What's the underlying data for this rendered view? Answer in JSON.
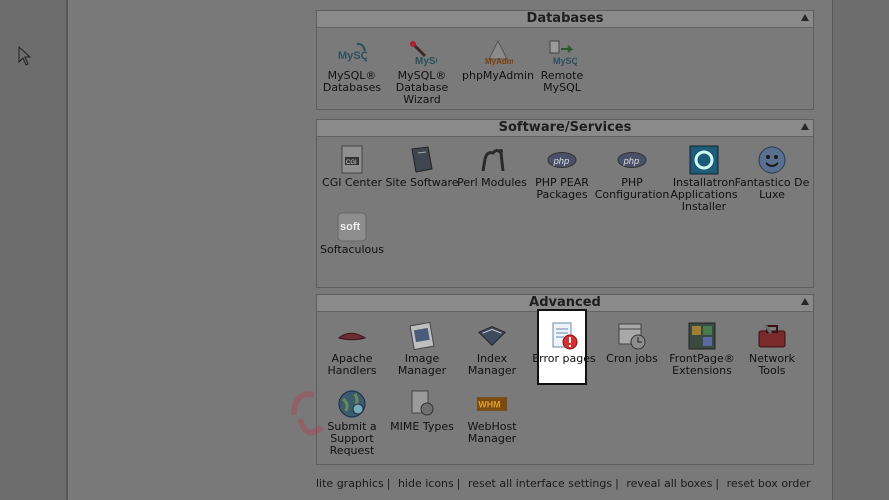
{
  "panels": {
    "databases": {
      "title": "Databases",
      "items": [
        {
          "label": "MySQL® Databases",
          "icon": "mysql-icon"
        },
        {
          "label": "MySQL® Database Wizard",
          "icon": "mysql-wizard-icon"
        },
        {
          "label": "phpMyAdmin",
          "icon": "phpmyadmin-icon"
        },
        {
          "label": "Remote MySQL",
          "icon": "remote-mysql-icon"
        }
      ]
    },
    "software": {
      "title": "Software/Services",
      "items": [
        {
          "label": "CGI Center",
          "icon": "cgi-icon"
        },
        {
          "label": "Site Software",
          "icon": "site-software-icon"
        },
        {
          "label": "Perl Modules",
          "icon": "perl-camel-icon"
        },
        {
          "label": "PHP PEAR Packages",
          "icon": "php-icon"
        },
        {
          "label": "PHP Configuration",
          "icon": "php-icon"
        },
        {
          "label": "Installatron Applications Installer",
          "icon": "installatron-icon"
        },
        {
          "label": "Fantastico De Luxe",
          "icon": "smiley-icon"
        },
        {
          "label": "Softaculous",
          "icon": "softaculous-icon"
        }
      ]
    },
    "advanced": {
      "title": "Advanced",
      "items": [
        {
          "label": "Apache Handlers",
          "icon": "feather-icon"
        },
        {
          "label": "Image Manager",
          "icon": "image-icon"
        },
        {
          "label": "Index Manager",
          "icon": "book-icon"
        },
        {
          "label": "Error pages",
          "icon": "error-page-icon"
        },
        {
          "label": "Cron jobs",
          "icon": "calendar-clock-icon"
        },
        {
          "label": "FrontPage® Extensions",
          "icon": "frontpage-icon"
        },
        {
          "label": "Network Tools",
          "icon": "toolbox-icon"
        },
        {
          "label": "Submit a Support Request",
          "icon": "support-globe-icon"
        },
        {
          "label": "MIME Types",
          "icon": "mime-icon"
        },
        {
          "label": "WebHost Manager",
          "icon": "whm-icon"
        }
      ]
    }
  },
  "footer": {
    "links": [
      "lite graphics",
      "hide icons",
      "reset all interface settings",
      "reveal all boxes",
      "reset box order"
    ]
  },
  "colors": {
    "highlight_border": "#111111",
    "highlight_bg": "#ffffff",
    "error_red": "#d63030"
  }
}
